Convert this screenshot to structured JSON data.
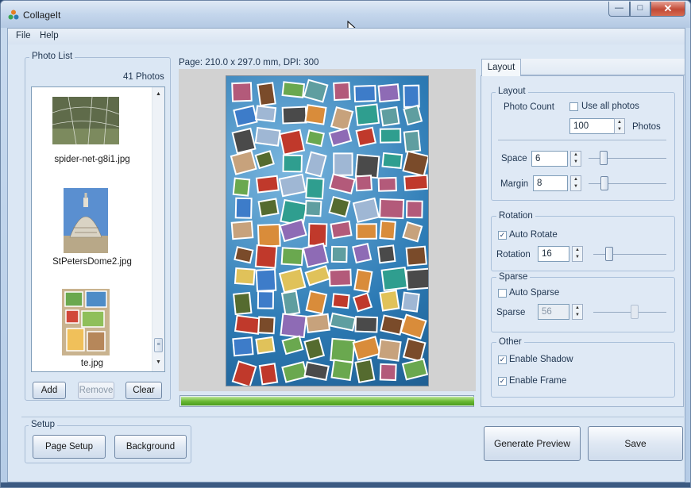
{
  "window": {
    "title": "CollageIt",
    "close_glyph": "✕",
    "max_glyph": "□",
    "min_glyph": "—"
  },
  "menu": {
    "items": [
      "File",
      "Help"
    ]
  },
  "photo_list": {
    "group_label": "Photo List",
    "count_label": "41 Photos",
    "items": [
      {
        "name": "spider-net-g8i1.jpg",
        "thumb": "spider-net"
      },
      {
        "name": "StPetersDome2.jpg",
        "thumb": "dome"
      },
      {
        "name": "te.jpg",
        "thumb": "collage"
      }
    ],
    "buttons": {
      "add": "Add",
      "remove": "Remove",
      "clear": "Clear"
    }
  },
  "preview": {
    "page_info": "Page: 210.0 x 297.0 mm, DPI: 300",
    "progress": 1.0
  },
  "settings": {
    "tab_label": "Layout",
    "layout": {
      "group_label": "Layout",
      "photo_count_label": "Photo Count",
      "use_all_label": "Use all photos",
      "use_all_checked": false,
      "photo_count_value": "100",
      "photos_unit": "Photos",
      "space_label": "Space",
      "space_value": "6",
      "margin_label": "Margin",
      "margin_value": "8"
    },
    "rotation": {
      "group_label": "Rotation",
      "auto_rotate_label": "Auto Rotate",
      "auto_rotate_checked": true,
      "rotation_label": "Rotation",
      "rotation_value": "16"
    },
    "sparse": {
      "group_label": "Sparse",
      "auto_sparse_label": "Auto Sparse",
      "auto_sparse_checked": false,
      "sparse_label": "Sparse",
      "sparse_value": "56"
    },
    "other": {
      "group_label": "Other",
      "enable_shadow_label": "Enable Shadow",
      "enable_shadow_checked": true,
      "enable_frame_label": "Enable Frame",
      "enable_frame_checked": true
    }
  },
  "setup": {
    "group_label": "Setup",
    "page_setup_label": "Page Setup",
    "background_label": "Background"
  },
  "actions": {
    "generate_preview_label": "Generate Preview",
    "save_label": "Save"
  },
  "check_glyph": "✓",
  "colors": {
    "progress": "#6cbb35",
    "page_background": "#2d7bb5"
  }
}
